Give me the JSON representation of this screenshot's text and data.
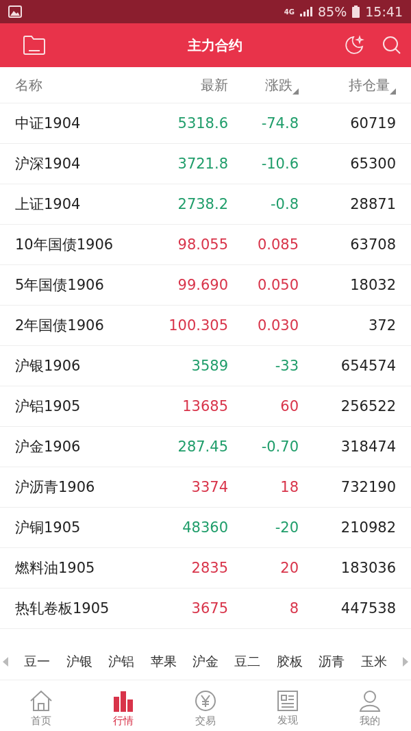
{
  "status_bar": {
    "network": "4G",
    "battery": "85%",
    "time": "15:41"
  },
  "header": {
    "title": "主力合约"
  },
  "table": {
    "columns": [
      {
        "label": "名称",
        "sortable": false
      },
      {
        "label": "最新",
        "sortable": false
      },
      {
        "label": "涨跌",
        "sortable": true
      },
      {
        "label": "持仓量",
        "sortable": true
      }
    ],
    "rows": [
      {
        "name": "中证1904",
        "last": "5318.6",
        "change": "-74.8",
        "open_interest": "60719",
        "rising": false
      },
      {
        "name": "沪深1904",
        "last": "3721.8",
        "change": "-10.6",
        "open_interest": "65300",
        "rising": false
      },
      {
        "name": "上证1904",
        "last": "2738.2",
        "change": "-0.8",
        "open_interest": "28871",
        "rising": false
      },
      {
        "name": "10年国债1906",
        "last": "98.055",
        "change": "0.085",
        "open_interest": "63708",
        "rising": true
      },
      {
        "name": "5年国债1906",
        "last": "99.690",
        "change": "0.050",
        "open_interest": "18032",
        "rising": true
      },
      {
        "name": "2年国债1906",
        "last": "100.305",
        "change": "0.030",
        "open_interest": "372",
        "rising": true
      },
      {
        "name": "沪银1906",
        "last": "3589",
        "change": "-33",
        "open_interest": "654574",
        "rising": false
      },
      {
        "name": "沪铝1905",
        "last": "13685",
        "change": "60",
        "open_interest": "256522",
        "rising": true
      },
      {
        "name": "沪金1906",
        "last": "287.45",
        "change": "-0.70",
        "open_interest": "318474",
        "rising": false
      },
      {
        "name": "沪沥青1906",
        "last": "3374",
        "change": "18",
        "open_interest": "732190",
        "rising": true
      },
      {
        "name": "沪铜1905",
        "last": "48360",
        "change": "-20",
        "open_interest": "210982",
        "rising": false
      },
      {
        "name": "燃料油1905",
        "last": "2835",
        "change": "20",
        "open_interest": "183036",
        "rising": true
      },
      {
        "name": "热轧卷板1905",
        "last": "3675",
        "change": "8",
        "open_interest": "447538",
        "rising": true
      }
    ]
  },
  "categories": [
    "豆一",
    "沪银",
    "沪铝",
    "苹果",
    "沪金",
    "豆二",
    "胶板",
    "沥青",
    "玉米"
  ],
  "nav": [
    {
      "label": "首页",
      "kind": "home",
      "selected": false
    },
    {
      "label": "行情",
      "kind": "chart",
      "selected": true
    },
    {
      "label": "交易",
      "kind": "coin",
      "selected": false
    },
    {
      "label": "发现",
      "kind": "news",
      "selected": false
    },
    {
      "label": "我的",
      "kind": "user",
      "selected": false
    }
  ]
}
